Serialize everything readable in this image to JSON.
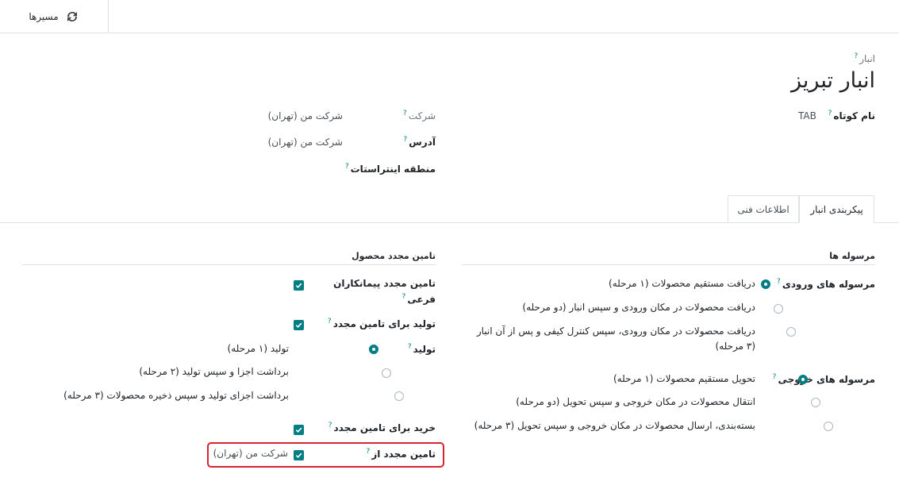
{
  "topbar": {
    "routes_button": "مسیرها",
    "routes_icon": "refresh-icon"
  },
  "header": {
    "record_type_label": "انبار",
    "title": "انبار تبریز",
    "short_name_label": "نام کوتاه",
    "short_name_value": "TAB",
    "company_label": "شرکت",
    "company_value": "شرکت من (تهران)",
    "address_label": "آدرس",
    "address_value": "شرکت من (تهران)",
    "intrastat_label": "منطقه اینتراستات",
    "help_mark": "?"
  },
  "tabs": [
    {
      "label": "پیکربندی انبار",
      "active": true
    },
    {
      "label": "اطلاعات فنی",
      "active": false
    }
  ],
  "shipments": {
    "title": "مرسوله ها",
    "incoming_label": "مرسوله های ورودی",
    "incoming_options": [
      {
        "label": "دریافت مستقیم محصولات (۱ مرحله)",
        "selected": true
      },
      {
        "label": "دریافت محصولات در مکان ورودی و سپس انبار (دو مرحله)",
        "selected": false
      },
      {
        "label_line1": "دریافت محصولات در مکان ورودی، سپس کنترل کیفی و پس از آن انبار",
        "label_line2": "(۳ مرحله)",
        "selected": false
      }
    ],
    "outgoing_label": "مرسوله های خروجی",
    "outgoing_options": [
      {
        "label": "تحویل مستقیم محصولات (۱ مرحله)",
        "selected": true
      },
      {
        "label": "انتقال محصولات در مکان خروجی و سپس تحویل (دو مرحله)",
        "selected": false
      },
      {
        "label": "بسته‌بندی، ارسال محصولات در مکان خروجی و سپس تحویل (۳ مرحله)",
        "selected": false
      }
    ]
  },
  "resupply": {
    "title": "تامین مجدد محصول",
    "subcontractor_label_line1": "تامین مجدد پیمانکاران",
    "subcontractor_label_line2": "فرعی",
    "subcontractor_checked": true,
    "manufacture_resupply_label": "تولید برای تامین مجدد",
    "manufacture_resupply_checked": true,
    "manufacture_label": "تولید",
    "manufacture_options": [
      {
        "label": "تولید (۱ مرحله)",
        "selected": true
      },
      {
        "label": "برداشت اجزا و سپس تولید (۲ مرحله)",
        "selected": false
      },
      {
        "label": "برداشت اجزای تولید و سپس ذخیره محصولات (۳ مرحله)",
        "selected": false
      }
    ],
    "buy_resupply_label": "خرید برای تامین مجدد",
    "buy_resupply_checked": true,
    "resupply_from_label": "تامین مجدد از",
    "resupply_from_value": "شرکت من (تهران)",
    "resupply_from_checked": true
  },
  "colors": {
    "accent": "#017e84",
    "highlight": "#d9232d",
    "border": "#dee2e6"
  }
}
